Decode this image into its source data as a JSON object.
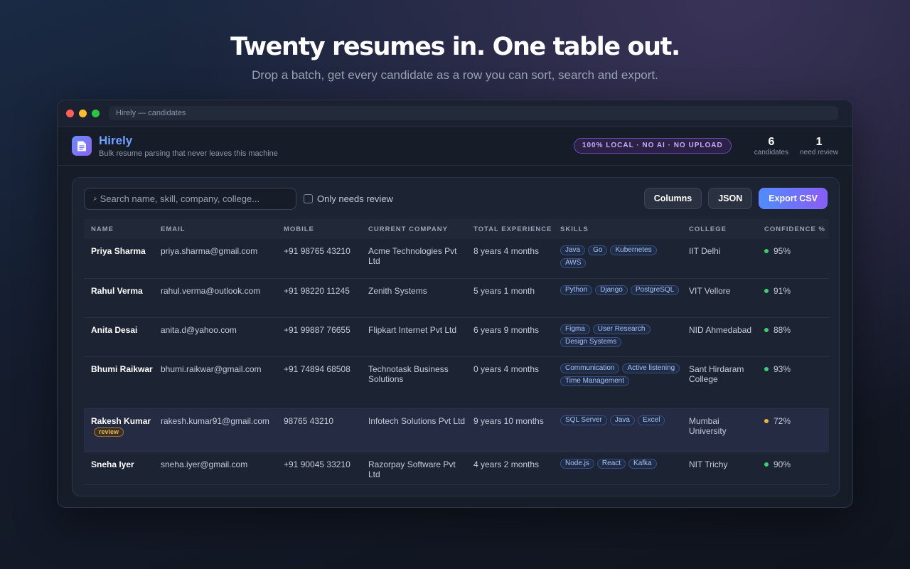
{
  "hero": {
    "title": "Twenty resumes in. One table out.",
    "subtitle": "Drop a batch, get every candidate as a row you can sort, search and export."
  },
  "window": {
    "title": "Hirely — candidates"
  },
  "app": {
    "name": "Hirely",
    "tagline": "Bulk resume parsing that never leaves this machine",
    "privacy_badge": "100% LOCAL · NO AI · NO UPLOAD",
    "stats": [
      {
        "value": "6",
        "label": "candidates"
      },
      {
        "value": "1",
        "label": "need review"
      }
    ]
  },
  "toolbar": {
    "search_placeholder": "Search name, skill, company, college...",
    "review_filter_label": "Only needs review",
    "columns_button": "Columns",
    "json_button": "JSON",
    "export_button": "Export CSV"
  },
  "table": {
    "headers": [
      "Name",
      "Email",
      "Mobile",
      "Current Company",
      "Total Experience",
      "Skills",
      "College",
      "Confidence %"
    ],
    "review_tag": "review",
    "rows": [
      {
        "name": "Priya Sharma",
        "email": "priya.sharma@gmail.com",
        "mobile": "+91 98765 43210",
        "company": "Acme Technologies Pvt Ltd",
        "experience": "8 years 4 months",
        "skills": [
          "Java",
          "Go",
          "Kubernetes",
          "AWS"
        ],
        "college": "IIT Delhi",
        "confidence": "95%",
        "status_color": "#3ecf6e",
        "needs_review": false
      },
      {
        "name": "Rahul Verma",
        "email": "rahul.verma@outlook.com",
        "mobile": "+91 98220 11245",
        "company": "Zenith Systems",
        "experience": "5 years 1 month",
        "skills": [
          "Python",
          "Django",
          "PostgreSQL"
        ],
        "college": "VIT Vellore",
        "confidence": "91%",
        "status_color": "#3ecf6e",
        "needs_review": false
      },
      {
        "name": "Anita Desai",
        "email": "anita.d@yahoo.com",
        "mobile": "+91 99887 76655",
        "company": "Flipkart Internet Pvt Ltd",
        "experience": "6 years 9 months",
        "skills": [
          "Figma",
          "User Research",
          "Design Systems"
        ],
        "college": "NID Ahmedabad",
        "confidence": "88%",
        "status_color": "#3ecf6e",
        "needs_review": false
      },
      {
        "name": "Bhumi Raikwar",
        "email": "bhumi.raikwar@gmail.com",
        "mobile": "+91 74894 68508",
        "company": "Technotask Business Solutions",
        "experience": "0 years 4 months",
        "skills": [
          "Communication",
          "Active listening",
          "Time Management"
        ],
        "college": "Sant Hirdaram College",
        "confidence": "93%",
        "status_color": "#3ecf6e",
        "needs_review": false
      },
      {
        "name": "Rakesh Kumar",
        "email": "rakesh.kumar91@gmail.com",
        "mobile": "98765 43210",
        "company": "Infotech Solutions Pvt Ltd",
        "experience": "9 years 10 months",
        "skills": [
          "SQL Server",
          "Java",
          "Excel"
        ],
        "college": "Mumbai University",
        "confidence": "72%",
        "status_color": "#f0b43c",
        "needs_review": true
      },
      {
        "name": "Sneha Iyer",
        "email": "sneha.iyer@gmail.com",
        "mobile": "+91 90045 33210",
        "company": "Razorpay Software Pvt Ltd",
        "experience": "4 years 2 months",
        "skills": [
          "Node.js",
          "React",
          "Kafka"
        ],
        "college": "NIT Trichy",
        "confidence": "90%",
        "status_color": "#3ecf6e",
        "needs_review": false
      }
    ]
  },
  "icons": {
    "logo": "document-icon",
    "search": "search-icon"
  }
}
